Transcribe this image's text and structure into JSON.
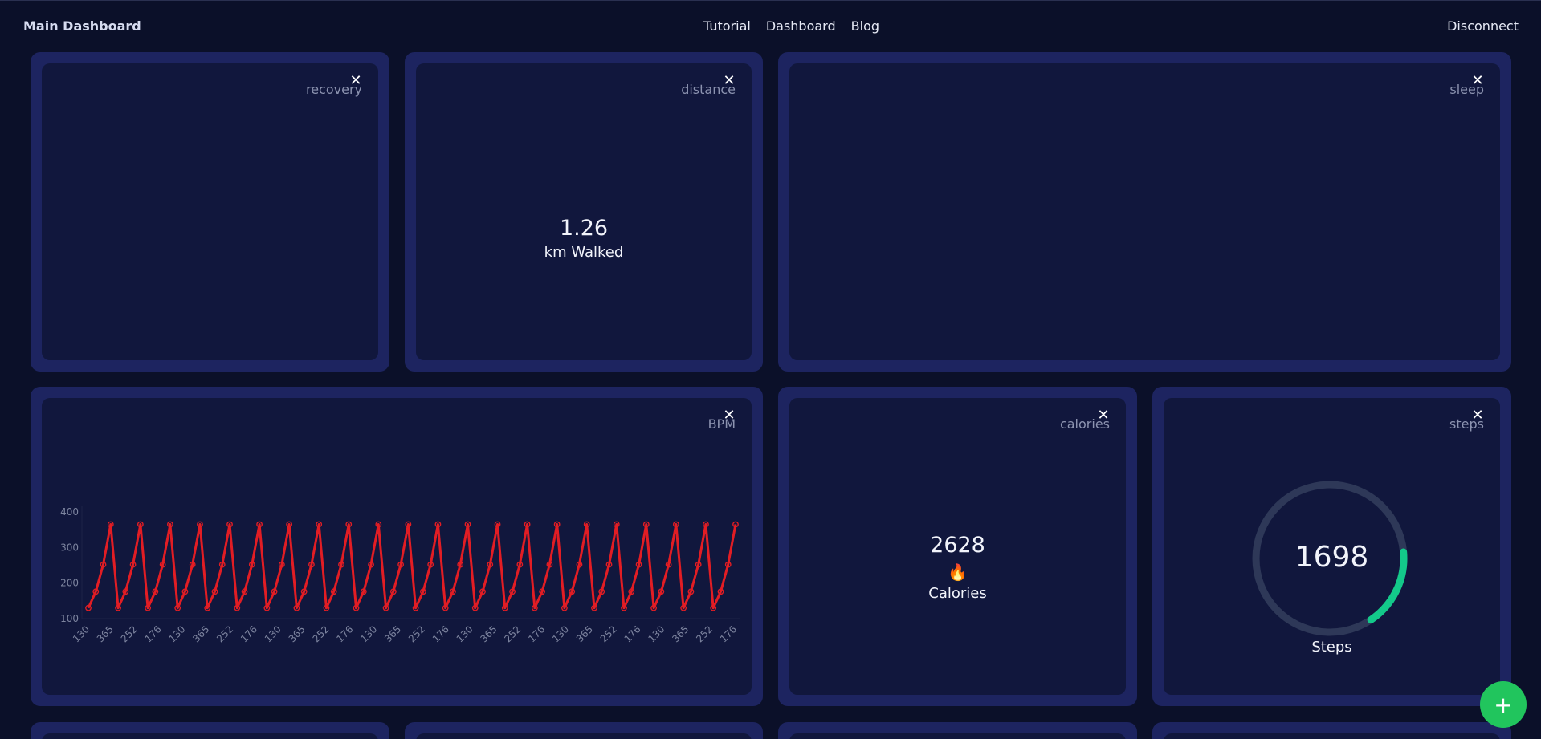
{
  "header": {
    "title": "Main Dashboard",
    "nav": [
      "Tutorial",
      "Dashboard",
      "Blog"
    ],
    "disconnect": "Disconnect"
  },
  "widgets": {
    "recovery": {
      "label": "recovery"
    },
    "distance": {
      "label": "distance",
      "value": "1.26",
      "unit": "km Walked"
    },
    "sleep": {
      "label": "sleep"
    },
    "bpm": {
      "label": "BPM"
    },
    "calories": {
      "label": "calories",
      "value": "2628",
      "icon": "🔥",
      "unit": "Calories"
    },
    "steps": {
      "label": "steps",
      "value": "1698",
      "unit": "Steps",
      "progress": 0.17
    }
  },
  "close_glyph": "✕",
  "fab_glyph": "+",
  "colors": {
    "background": "#0b1029",
    "card": "#1d2460",
    "card_inner": "#11173d",
    "line": "#e21d24",
    "ring_track": "#2e3858",
    "ring_fill": "#13c98a",
    "fab": "#21c55d"
  },
  "chart_data": {
    "type": "line",
    "title": "",
    "xlabel": "",
    "ylabel": "",
    "ylim": [
      100,
      400
    ],
    "yticks": [
      100,
      200,
      300,
      400
    ],
    "x": [
      "130",
      "176",
      "252",
      "365",
      "130",
      "176",
      "252",
      "365",
      "130",
      "176",
      "252",
      "365",
      "130",
      "176",
      "252",
      "365",
      "130",
      "176",
      "252",
      "365",
      "130",
      "176",
      "252",
      "365",
      "130",
      "176",
      "252",
      "365",
      "130",
      "176",
      "252",
      "365",
      "130",
      "176",
      "252",
      "365",
      "130",
      "176",
      "252",
      "365",
      "130",
      "176",
      "252",
      "365",
      "130",
      "176",
      "252",
      "365",
      "130",
      "176",
      "252",
      "365",
      "130",
      "176",
      "252",
      "365",
      "130",
      "176",
      "252",
      "365",
      "130",
      "176",
      "252",
      "365",
      "130",
      "176",
      "252",
      "365",
      "130",
      "176",
      "252",
      "365",
      "130",
      "176",
      "252",
      "365",
      "130",
      "176",
      "252",
      "365",
      "130",
      "176",
      "252",
      "365",
      "130",
      "176",
      "252",
      "365"
    ],
    "xtick_labels": [
      "130",
      "365",
      "252",
      "176",
      "130",
      "365",
      "252",
      "176",
      "130",
      "365",
      "252",
      "176",
      "130",
      "365",
      "252",
      "176",
      "130",
      "365",
      "252",
      "176",
      "130",
      "365",
      "252",
      "176",
      "130",
      "365",
      "252",
      "176"
    ],
    "series": [
      {
        "values": [
          130,
          176,
          252,
          365,
          130,
          176,
          252,
          365,
          130,
          176,
          252,
          365,
          130,
          176,
          252,
          365,
          130,
          176,
          252,
          365,
          130,
          176,
          252,
          365,
          130,
          176,
          252,
          365,
          130,
          176,
          252,
          365,
          130,
          176,
          252,
          365,
          130,
          176,
          252,
          365,
          130,
          176,
          252,
          365,
          130,
          176,
          252,
          365,
          130,
          176,
          252,
          365,
          130,
          176,
          252,
          365,
          130,
          176,
          252,
          365,
          130,
          176,
          252,
          365,
          130,
          176,
          252,
          365,
          130,
          176,
          252,
          365,
          130,
          176,
          252,
          365,
          130,
          176,
          252,
          365,
          130,
          176,
          252,
          365,
          130,
          176,
          252,
          365
        ]
      }
    ],
    "grid": false,
    "legend": "none"
  }
}
